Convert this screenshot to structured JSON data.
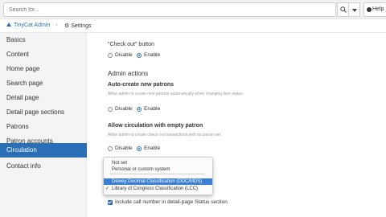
{
  "topbar": {
    "search_placeholder": "Search for...",
    "help_label": "Help"
  },
  "breadcrumb": {
    "home": "TinyCat Admin",
    "separator": "›",
    "current": "Settings"
  },
  "sidebar": {
    "items": [
      {
        "label": "Basics"
      },
      {
        "label": "Content"
      },
      {
        "label": "Home page"
      },
      {
        "label": "Search page"
      },
      {
        "label": "Detail page"
      },
      {
        "label": "Detail page sections"
      },
      {
        "label": "Patrons"
      },
      {
        "label": "Patron accounts"
      },
      {
        "label": "Circulation",
        "active": true
      },
      {
        "label": "Contact info"
      }
    ]
  },
  "main": {
    "checkout_button": {
      "label": "\"Check out\" button",
      "options": [
        "Disable",
        "Enable"
      ],
      "selected": "Enable"
    },
    "admin_actions": {
      "title": "Admin actions"
    },
    "auto_create": {
      "label": "Auto-create new patrons",
      "help": "Allow admin to create new patrons automatically when changing item status.",
      "options": [
        "Disable",
        "Enable"
      ],
      "selected": "Enable"
    },
    "empty_patron": {
      "label": "Allow circulation with empty patron",
      "help": "Allow admin to create check-out transactions with no patron set.",
      "options": [
        "Disable",
        "Enable"
      ],
      "selected": "Enable"
    },
    "classification_dropdown": {
      "options": [
        {
          "label": "Not set"
        },
        {
          "label": "Personal or custom system"
        },
        {
          "label": "Dewey Decimal Classification (DDC/MDS)",
          "highlighted": true
        },
        {
          "label": "Library of Congress Classification (LCC)",
          "checked": true
        }
      ]
    },
    "call_number_checkbox": {
      "label": "Include call number in detail-page Status section",
      "checked": true
    }
  },
  "colors": {
    "accent": "#2a6fb5",
    "highlight": "#3a7fd3"
  }
}
